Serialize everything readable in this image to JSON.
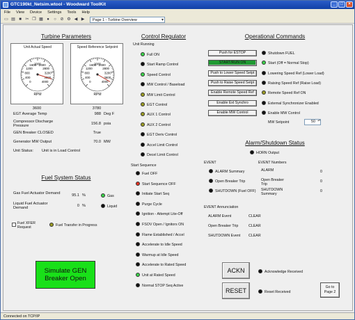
{
  "window": {
    "title": "GTC190kt_Netsim.wtool - Woodward ToolKit",
    "buttons": [
      "_",
      "□",
      "×"
    ]
  },
  "menu": [
    "File",
    "View",
    "Device",
    "Settings",
    "Tools",
    "Help"
  ],
  "toolbar": {
    "icons": [
      "new-icon",
      "open-icon",
      "save-icon",
      "cut-icon",
      "copy-icon",
      "paste-icon",
      "connect-icon",
      "disconnect-icon",
      "stop-icon",
      "settings-icon",
      "back-icon",
      "forward-icon"
    ],
    "glyphs": [
      "▭",
      "▤",
      "■",
      "✂",
      "❐",
      "▦",
      "●",
      "○",
      "⊘",
      "⚙",
      "◀",
      "▶"
    ],
    "page_selector": "Page 1 - Turbine Overview"
  },
  "turbine": {
    "title": "Turbine Parameters",
    "gauge1": {
      "title": "Unit Actual Speed",
      "unit": "RPM",
      "value": "3600",
      "needle": 3600,
      "max": 4000,
      "ticks": [
        "0",
        "400",
        "800",
        "1200",
        "1600",
        "2000",
        "2400",
        "2800",
        "3200",
        "3600",
        "4000"
      ]
    },
    "gauge2": {
      "title": "Speed Reference Setpoint",
      "unit": "RPM",
      "value": "3780",
      "needle": 3780,
      "max": 4000,
      "ticks": [
        "0",
        "400",
        "800",
        "1200",
        "1600",
        "2000",
        "2400",
        "2800",
        "3200",
        "3600",
        "4000"
      ]
    },
    "rows": [
      {
        "label": "EGT Average Temp",
        "value": "988",
        "unit": "Deg F"
      },
      {
        "label": "Compressor Discharge Pressure",
        "value": "156.8",
        "unit": "psia"
      },
      {
        "label": "GEN Breaker CLOSED",
        "value": "True",
        "unit": ""
      },
      {
        "label": "Generator MW Output",
        "value": "70.0",
        "unit": "MW"
      }
    ],
    "status_label": "Unit Status:",
    "status_value": "Unit is in Load Control"
  },
  "fuel": {
    "title": "Fuel System Status",
    "gas_label": "Gas Fuel Actuator Demand",
    "gas_value": "95.1",
    "gas_unit": "%",
    "gas_led_label": "Gas",
    "liq_label": "Liquid Fuel Actuator Demand",
    "liq_value": "0",
    "liq_unit": "%",
    "liq_led_label": "Liquid",
    "xfer_label": "Fuel XFER Request",
    "xfer_progress": "Fuel Transfer in Progress",
    "sim_button": "Simulate GEN Breaker Open"
  },
  "regulator": {
    "title": "Control Regulator",
    "running_label": "Unit Running",
    "running": [
      {
        "label": "Full ON",
        "color": "green"
      },
      {
        "label": "Start Ramp Control",
        "color": "black"
      },
      {
        "label": "Speed Control",
        "color": "green"
      },
      {
        "label": "MW Control / Baseload",
        "color": "black"
      },
      {
        "label": "MW Limit Control",
        "color": "olive"
      },
      {
        "label": "EGT Control",
        "color": "olive"
      },
      {
        "label": "AUX 1 Control",
        "color": "olive"
      },
      {
        "label": "AUX 2 Control",
        "color": "olive"
      },
      {
        "label": "EGT Deriv Control",
        "color": "black"
      },
      {
        "label": "Accel Limit Control",
        "color": "black"
      },
      {
        "label": "Decel Limit Control",
        "color": "black"
      }
    ],
    "start_label": "Start Sequence",
    "start": [
      {
        "label": "Fuel OFF",
        "color": "black"
      },
      {
        "label": "Start Sequence OFF",
        "color": "red"
      },
      {
        "label": "Initiate Start Seq",
        "color": "black"
      },
      {
        "label": "Purge Cycle",
        "color": "black"
      },
      {
        "label": "Ignition - Attempt Lite-Off",
        "color": "black"
      },
      {
        "label": "FSOV Open / Ignitors ON",
        "color": "black"
      },
      {
        "label": "Flame Established / Accel",
        "color": "black"
      },
      {
        "label": "Accelerate to Idle Speed",
        "color": "black"
      },
      {
        "label": "Warmup at Idle Speed",
        "color": "black"
      },
      {
        "label": "Accelerate to Rated Speed",
        "color": "black"
      },
      {
        "label": "Unit at Rated Speed",
        "color": "green"
      },
      {
        "label": "Normal STOP Seq Active",
        "color": "black"
      }
    ]
  },
  "operational": {
    "title": "Operational Commands",
    "commands": [
      {
        "button": "Push for ESTOP",
        "led": "Shutdown FUEL",
        "color": "black",
        "pressed": false
      },
      {
        "button": "START/RUN ON",
        "led": "Start (Off = Normal Stop)",
        "color": "green",
        "pressed": true
      },
      {
        "button": "Push to Lower Speed Setpt",
        "led": "Lowering Speed Ref (Lower Load)",
        "color": "black",
        "pressed": false
      },
      {
        "button": "Push to Raise Speed Setpt",
        "led": "Raising Speed Ref (Raise Load)",
        "color": "black",
        "pressed": false
      },
      {
        "button": "Enable Remote Speed Ref",
        "led": "Remote Speed Ref ON",
        "color": "olive",
        "pressed": false
      },
      {
        "button": "Enable Ext Synchro",
        "led": "External Synchronizer Enabled",
        "color": "black",
        "pressed": false
      },
      {
        "button": "Enable MW Control",
        "led": "Enable MW Control",
        "color": "black",
        "pressed": false
      }
    ],
    "setpoint_label": "MW Setpoint",
    "setpoint_value": "50"
  },
  "alarm": {
    "title": "Alarm/Shutdown Status",
    "horn": "HORN Output",
    "event_hdr": "EVENT",
    "numbers_hdr": "EVENT Numbers",
    "events": [
      {
        "label": "ALARM Summary",
        "num_label": "ALARM",
        "num": "0"
      },
      {
        "label": "Open Breaker Trip",
        "num_label": "Open Breaker Trip",
        "num": "0"
      },
      {
        "label": "SHUTDOWN (Fuel OFF)",
        "num_label": "SHUTDOWN Summary",
        "num": "0"
      }
    ],
    "annun_hdr": "EVENT Annunciation",
    "annun": [
      {
        "label": "ALARM Event",
        "value": "CLEAR"
      },
      {
        "label": "Open Breaker Trip",
        "value": "CLEAR"
      },
      {
        "label": "SHUTDOWN Event",
        "value": "CLEAR"
      }
    ],
    "ackn": "ACKN",
    "reset": "RESET",
    "ack_received": "Acknowledge Received",
    "reset_received": "Reset Received",
    "goto": "Go to Page 2"
  },
  "statusbar": "Connected on TCP/IP"
}
